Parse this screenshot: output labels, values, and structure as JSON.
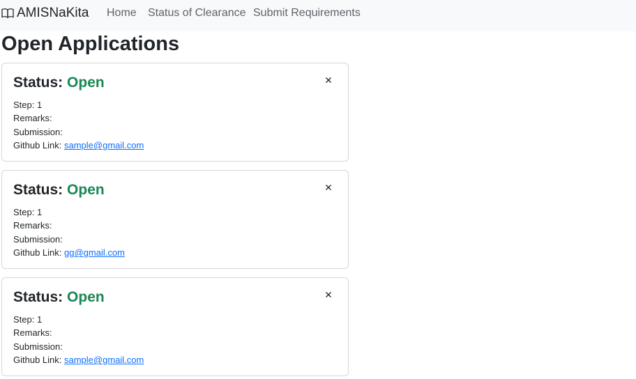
{
  "navbar": {
    "brand": "AMISNaKita",
    "links": [
      "Home",
      "Status of Clearance",
      "Submit Requirements"
    ]
  },
  "page": {
    "title": "Open Applications"
  },
  "colors": {
    "status_open": "#198754",
    "link": "#0d6efd"
  },
  "icons": {
    "brand": "book-icon",
    "close": "close-icon"
  },
  "applications": [
    {
      "status_label": "Status:",
      "status_value": "Open",
      "step_label": "Step:",
      "step_value": "1",
      "remarks_label": "Remarks:",
      "remarks_value": "",
      "submission_label": "Submission:",
      "submission_value": "",
      "github_label": "Github Link:",
      "github_value": "sample@gmail.com"
    },
    {
      "status_label": "Status:",
      "status_value": "Open",
      "step_label": "Step:",
      "step_value": "1",
      "remarks_label": "Remarks:",
      "remarks_value": "",
      "submission_label": "Submission:",
      "submission_value": "",
      "github_label": "Github Link:",
      "github_value": "gg@gmail.com"
    },
    {
      "status_label": "Status:",
      "status_value": "Open",
      "step_label": "Step:",
      "step_value": "1",
      "remarks_label": "Remarks:",
      "remarks_value": "",
      "submission_label": "Submission:",
      "submission_value": "",
      "github_label": "Github Link:",
      "github_value": "sample@gmail.com"
    }
  ]
}
